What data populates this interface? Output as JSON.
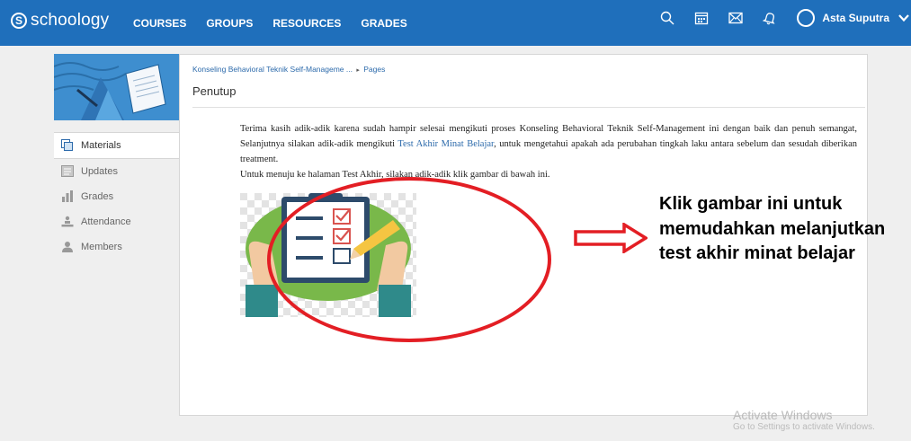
{
  "topbar": {
    "logo_text": "schoology",
    "logo_letter": "S",
    "nav": [
      "COURSES",
      "GROUPS",
      "RESOURCES",
      "GRADES"
    ],
    "user_name": "Asta Suputra",
    "icons": [
      "search-icon",
      "calendar-icon",
      "mail-icon",
      "bell-icon",
      "avatar",
      "chevron-down-icon"
    ]
  },
  "sidebar": {
    "items": [
      {
        "label": "Materials",
        "icon": "materials-icon",
        "active": true
      },
      {
        "label": "Updates",
        "icon": "updates-icon"
      },
      {
        "label": "Grades",
        "icon": "grades-icon"
      },
      {
        "label": "Attendance",
        "icon": "attendance-icon"
      },
      {
        "label": "Members",
        "icon": "members-icon"
      }
    ]
  },
  "main": {
    "breadcrumb_course": "Konseling Behavioral Teknik Self-Manageme ...",
    "breadcrumb_sep": "▸",
    "breadcrumb_page": "Pages",
    "title": "Penutup",
    "para1_a": "Terima kasih adik-adik karena sudah hampir selesai mengikuti proses Konseling Behavioral Teknik Self-Management ini dengan baik dan penuh semangat, Selanjutnya silakan adik-adik mengikuti ",
    "para1_link": "Test Akhir Minat Belajar",
    "para1_b": ", untuk mengetahui apakah ada perubahan tingkah laku antara sebelum dan sesudah diberikan treatment.",
    "para2": "Untuk menuju ke halaman Test Akhir, silakan adik-adik klik gambar di bawah ini."
  },
  "annotation": {
    "line1": "Klik gambar ini untuk",
    "line2": "memudahkan melanjutkan",
    "line3": "test akhir minat belajar",
    "color": "#e31e24"
  },
  "watermark": {
    "line1": "Activate Windows",
    "line2": "Go to Settings to activate Windows."
  },
  "colors": {
    "topbar": "#1f6fbb",
    "link": "#2c6aab",
    "annotation_red": "#e31e24"
  }
}
